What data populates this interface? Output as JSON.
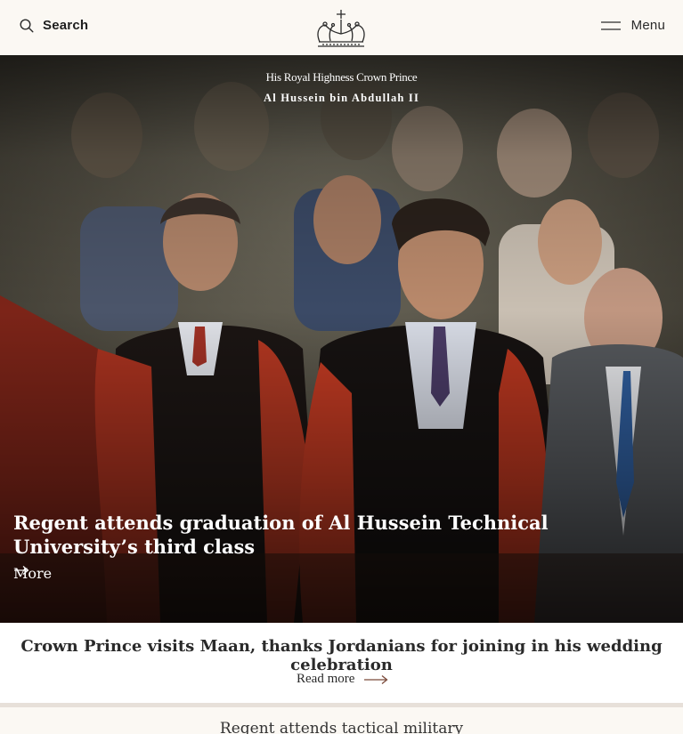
{
  "header": {
    "search_label": "Search",
    "menu_label": "Menu",
    "brand_line1": "His Royal Highness Crown Prince",
    "brand_line2": "Al Hussein bin Abdullah II"
  },
  "hero": {
    "title": "Regent attends graduation of Al Hussein Technical University’s third class",
    "more_label": "More"
  },
  "card": {
    "title": "Crown Prince visits Maan, thanks Jordanians for joining in his wedding celebration",
    "more_label": "Read more"
  },
  "next_card": {
    "title": "Regent attends tactical military"
  },
  "icons": [
    "search-icon",
    "menu-icon",
    "crown-icon",
    "arrow-right-icon"
  ],
  "colors": {
    "header_bg": "#fbf8f3",
    "accent_arrow": "#7a4a3a",
    "divider": "#e7e0d9"
  }
}
